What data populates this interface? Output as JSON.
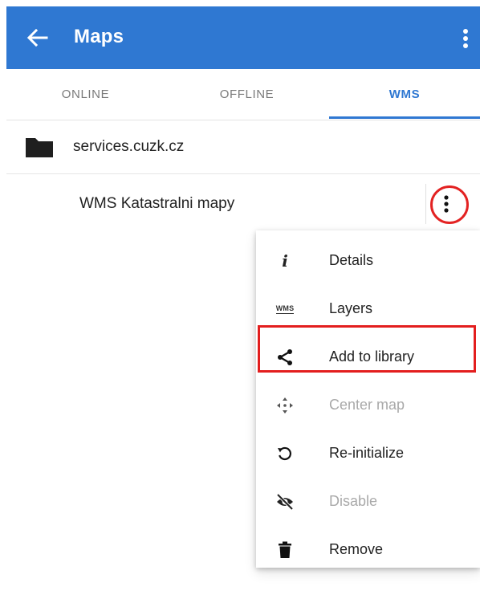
{
  "appbar": {
    "title": "Maps",
    "back_icon": "arrow-left-icon",
    "overflow_icon": "more-vert-icon",
    "color": "#2f78d2"
  },
  "tabs": [
    {
      "label": "ONLINE",
      "active": false
    },
    {
      "label": "OFFLINE",
      "active": false
    },
    {
      "label": "WMS",
      "active": true
    }
  ],
  "folder": {
    "label": "services.cuzk.cz",
    "icon": "folder-icon"
  },
  "item": {
    "label": "WMS Katastralni mapy",
    "more_icon": "more-vert-icon"
  },
  "menu": {
    "items": [
      {
        "label": "Details",
        "icon": "info-icon",
        "icon_text": "i",
        "enabled": true
      },
      {
        "label": "Layers",
        "icon": "wms-layers-icon",
        "icon_text": "WMS",
        "enabled": true
      },
      {
        "label": "Add to library",
        "icon": "share-icon",
        "enabled": true,
        "highlighted": true
      },
      {
        "label": "Center map",
        "icon": "center-map-icon",
        "enabled": false
      },
      {
        "label": "Re-initialize",
        "icon": "reload-icon",
        "enabled": true
      },
      {
        "label": "Disable",
        "icon": "eye-off-icon",
        "enabled": false
      },
      {
        "label": "Remove",
        "icon": "trash-icon",
        "enabled": true
      }
    ]
  },
  "annotation_color": "#e31e1e"
}
